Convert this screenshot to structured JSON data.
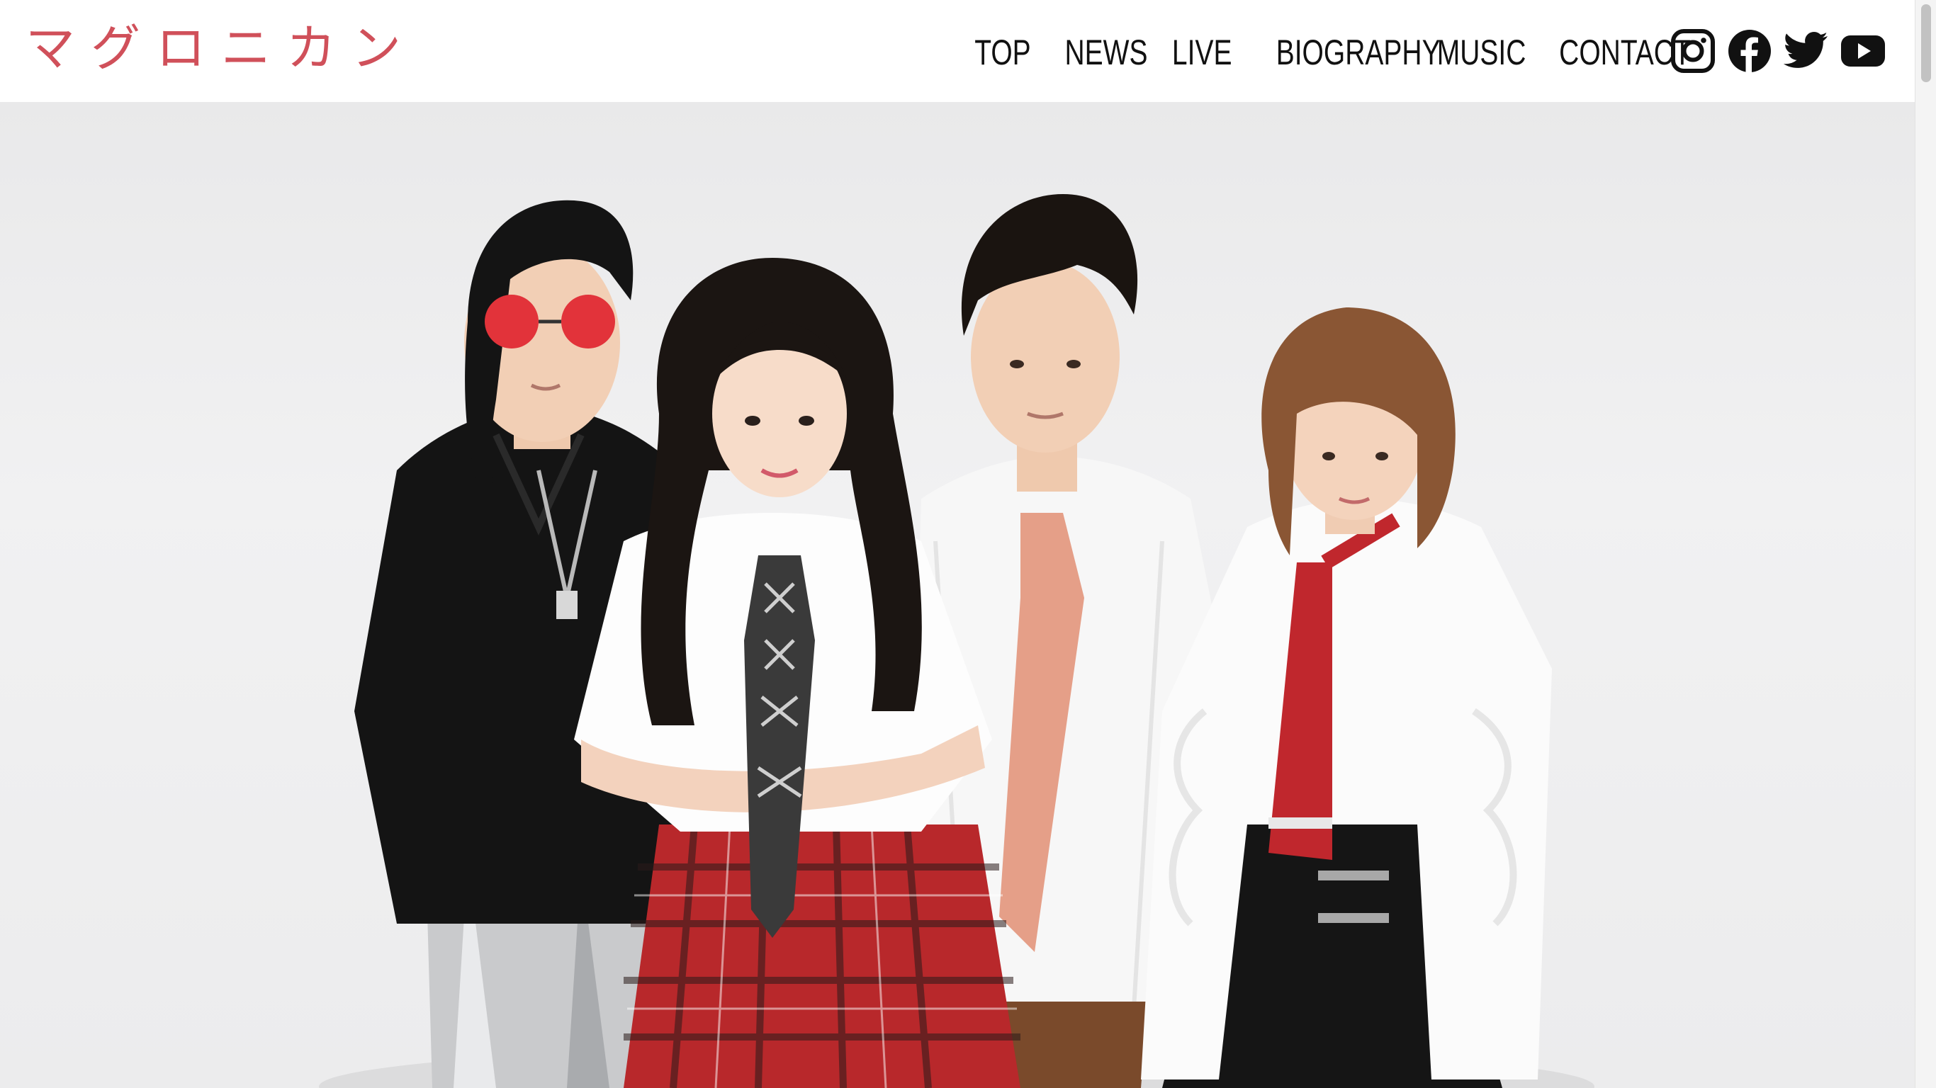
{
  "header": {
    "logo_text": "マグロニカン",
    "brand_color": "#d0505a"
  },
  "nav": {
    "items": [
      {
        "label": "TOP"
      },
      {
        "label": "NEWS"
      },
      {
        "label": "LIVE"
      },
      {
        "label": "BIOGRAPHY"
      },
      {
        "label": "MUSIC"
      },
      {
        "label": "CONTACT"
      }
    ]
  },
  "social": {
    "icons": [
      "instagram-icon",
      "facebook-icon",
      "twitter-icon",
      "youtube-icon"
    ]
  },
  "hero": {
    "image": "band-group-photo"
  }
}
